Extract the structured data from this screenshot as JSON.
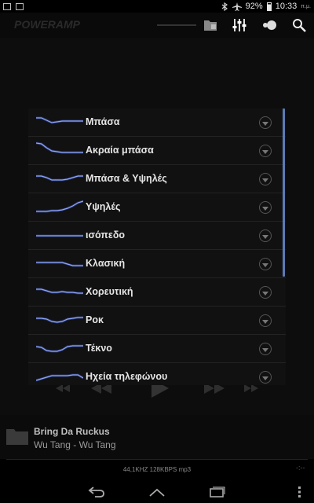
{
  "status": {
    "battery": "92%",
    "time": "10:33",
    "ampm": "π.μ."
  },
  "app": {
    "logo": "POWERAMP"
  },
  "dialog": {
    "presets": [
      {
        "label": "Μπάσα",
        "curve": [
          6,
          6,
          9,
          12,
          11,
          10,
          10,
          10,
          10,
          10
        ]
      },
      {
        "label": "Ακραία μπάσα",
        "curve": [
          2,
          3,
          8,
          12,
          13,
          14,
          14,
          14,
          14,
          14
        ]
      },
      {
        "label": "Μπάσα & Υψηλές",
        "curve": [
          8,
          8,
          10,
          13,
          13,
          13,
          12,
          10,
          8,
          8
        ]
      },
      {
        "label": "Υψηλές",
        "curve": [
          17,
          17,
          17,
          16,
          16,
          15,
          13,
          10,
          6,
          4
        ]
      },
      {
        "label": "ισόπεδο",
        "curve": [
          12,
          12,
          12,
          12,
          12,
          12,
          12,
          12,
          12,
          12
        ]
      },
      {
        "label": "Κλασική",
        "curve": [
          10,
          10,
          10,
          10,
          10,
          10,
          12,
          14,
          14,
          14
        ]
      },
      {
        "label": "Χορευτική",
        "curve": [
          8,
          8,
          10,
          12,
          12,
          11,
          12,
          12,
          13,
          13
        ]
      },
      {
        "label": "Ροκ",
        "curve": [
          9,
          9,
          10,
          13,
          14,
          13,
          10,
          9,
          8,
          8
        ]
      },
      {
        "label": "Τέκνο",
        "curve": [
          9,
          10,
          14,
          15,
          15,
          13,
          9,
          8,
          8,
          8
        ]
      },
      {
        "label": "Ηχεία τηλεφώνου",
        "curve": [
          16,
          14,
          12,
          10,
          10,
          10,
          10,
          9,
          9,
          13
        ]
      }
    ]
  },
  "track": {
    "title": "Bring Da Ruckus",
    "artist": "Wu Tang - Wu Tang",
    "info": "44,1KHZ  128KBPS  mp3",
    "time": "-:--"
  },
  "colors": {
    "curve": "#8fa6ff",
    "scrollbar": "#5b7bb5"
  }
}
